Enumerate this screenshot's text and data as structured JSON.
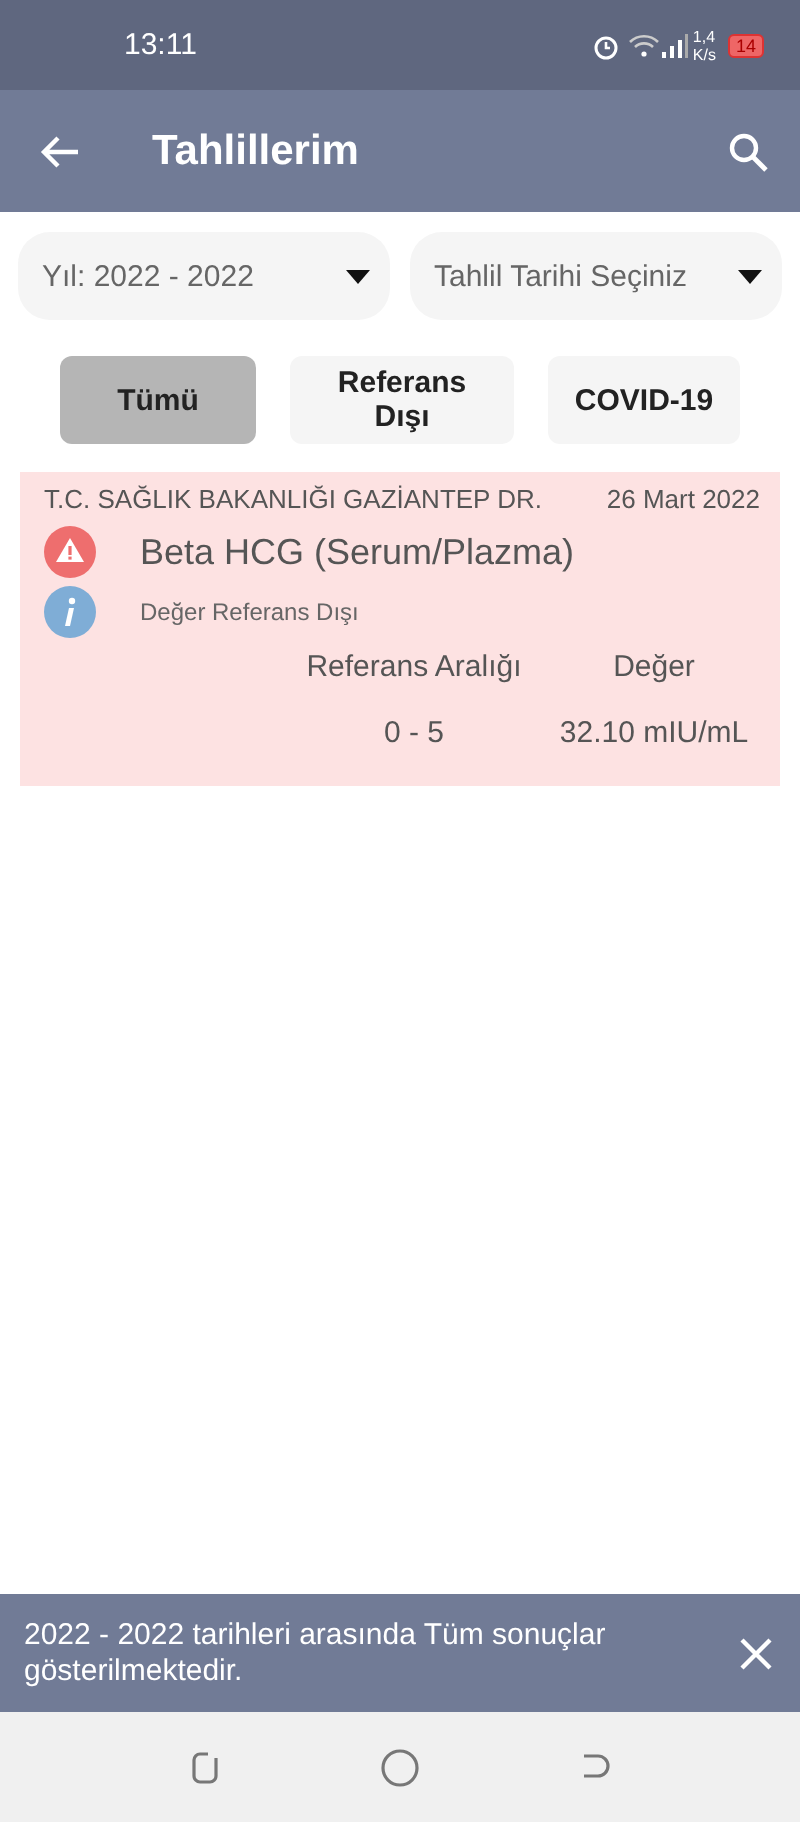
{
  "status_bar": {
    "time": "13:11",
    "speed_value": "1,4",
    "speed_unit": "K/s",
    "battery": "14"
  },
  "app_bar": {
    "title": "Tahlillerim"
  },
  "filters": [
    {
      "label": "Yıl: 2022 - 2022"
    },
    {
      "label": "Tahlil Tarihi Seçiniz"
    }
  ],
  "tabs": [
    {
      "label": "Tümü",
      "selected": true
    },
    {
      "label": "Referans Dışı",
      "selected": false
    },
    {
      "label": "COVID-19",
      "selected": false
    }
  ],
  "results": [
    {
      "institution": "T.C. SAĞLIK BAKANLIĞI GAZİANTEP DR.",
      "date": "26 Mart 2022",
      "test": "Beta HCG (Serum/Plazma)",
      "note": "Değer Referans Dışı",
      "out_of_range": true,
      "columns": [
        "Referans Aralığı",
        "Değer"
      ],
      "values": [
        "0 - 5",
        "32.10 mIU/mL"
      ]
    }
  ],
  "snackbar": {
    "message": "2022 - 2022 tarihleri arasında Tüm sonuçlar gösterilmektedir."
  }
}
